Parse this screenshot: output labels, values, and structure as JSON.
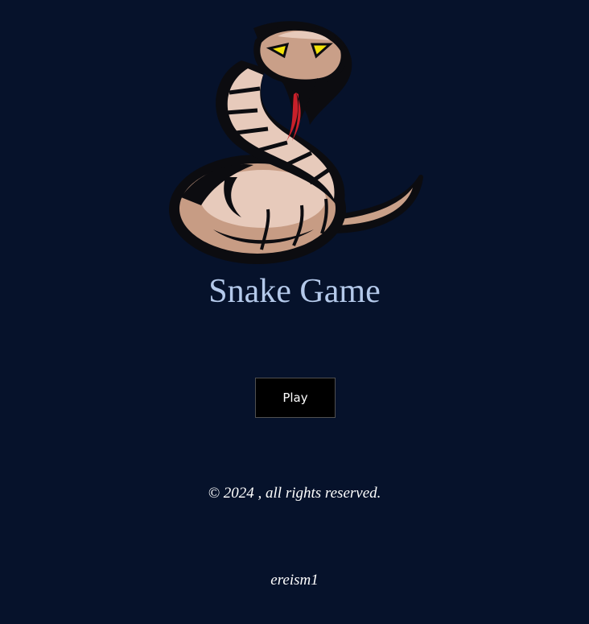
{
  "app": {
    "logo_icon": "snake-mascot-icon",
    "title": "Snake Game",
    "play_label": "Play",
    "copyright": "© 2024 , all rights reserved.",
    "author": "ereism1"
  },
  "colors": {
    "background": "#06122b",
    "title": "#b4c9ea",
    "button_bg": "#000000",
    "button_text": "#ffffff",
    "footer_text": "#ffffff"
  }
}
